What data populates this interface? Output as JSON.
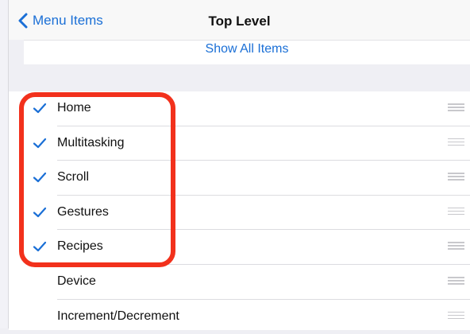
{
  "nav": {
    "back_label": "Menu Items",
    "title": "Top Level"
  },
  "show_all": {
    "label": "Show All Items"
  },
  "colors": {
    "accent": "#1a6fd6",
    "highlight": "#f2311c"
  },
  "items": [
    {
      "label": "Home",
      "checked": true
    },
    {
      "label": "Multitasking",
      "checked": true
    },
    {
      "label": "Scroll",
      "checked": true
    },
    {
      "label": "Gestures",
      "checked": true
    },
    {
      "label": "Recipes",
      "checked": true
    },
    {
      "label": "Device",
      "checked": false
    },
    {
      "label": "Increment/Decrement",
      "checked": false
    }
  ]
}
